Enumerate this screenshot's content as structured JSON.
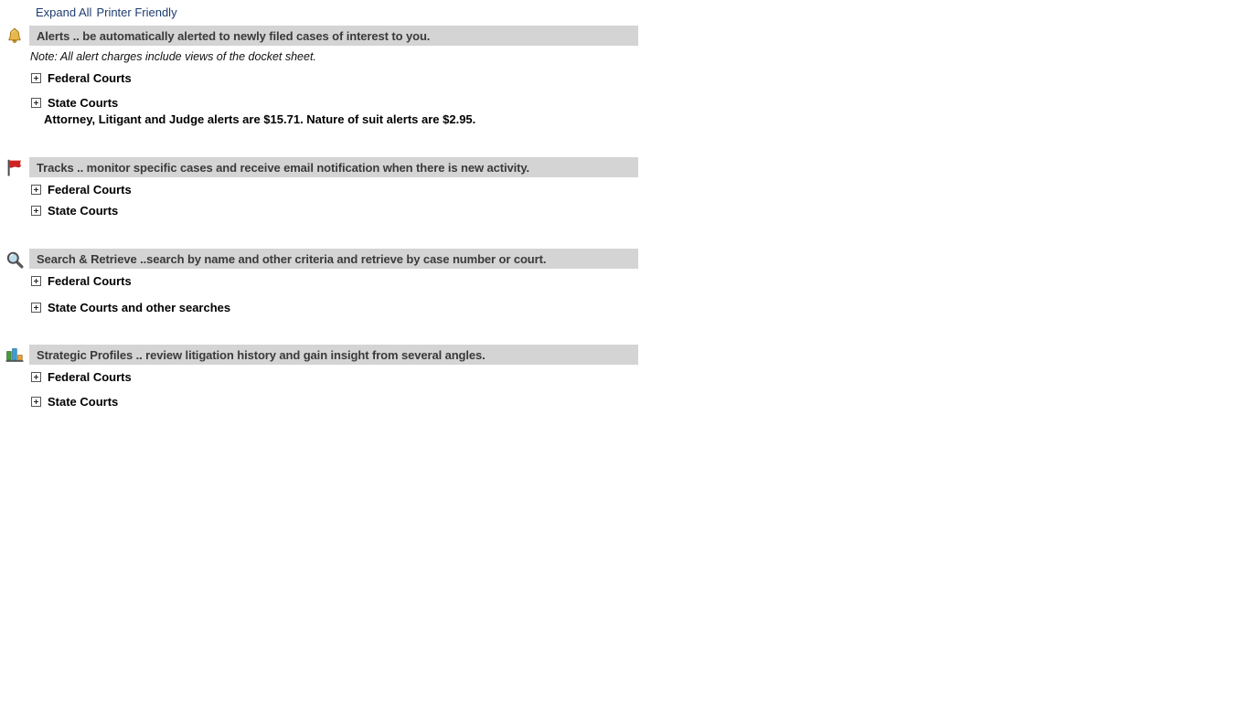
{
  "toolbar": {
    "expand_all_label": "Expand All",
    "printer_friendly_label": "Printer Friendly"
  },
  "sections": [
    {
      "icon": "bell-icon",
      "heading": "Alerts .. be automatically alerted to newly filed cases of interest to you.",
      "note": "Note: All alert charges include views of the docket sheet.",
      "items": [
        {
          "label": "Federal Courts"
        },
        {
          "label": "State Courts"
        }
      ],
      "pricing": "Attorney, Litigant and Judge alerts are $15.71. Nature of suit alerts are $2.95."
    },
    {
      "icon": "flag-icon",
      "heading": "Tracks .. monitor specific cases and receive email notification when there is new activity.",
      "items": [
        {
          "label": "Federal Courts"
        },
        {
          "label": "State Courts"
        }
      ]
    },
    {
      "icon": "search-icon",
      "heading": "Search & Retrieve ..search by name and other criteria and retrieve by case number or court.",
      "items": [
        {
          "label": "Federal Courts"
        },
        {
          "label": "State Courts and other searches"
        }
      ]
    },
    {
      "icon": "bar-chart-icon",
      "heading": "Strategic Profiles .. review litigation history and gain insight from several angles.",
      "items": [
        {
          "label": "Federal Courts"
        },
        {
          "label": "State Courts"
        }
      ]
    }
  ],
  "colors": {
    "header_bar": "#d4d4d4",
    "link": "#1f3d70",
    "heading_text": "#3a3a3a",
    "bell": "#e0a82e",
    "flag": "#d32020",
    "lens": "#bcdcea",
    "bar_green": "#4a9a40",
    "bar_blue": "#3d9fd6",
    "bar_orange": "#e8a33d"
  }
}
